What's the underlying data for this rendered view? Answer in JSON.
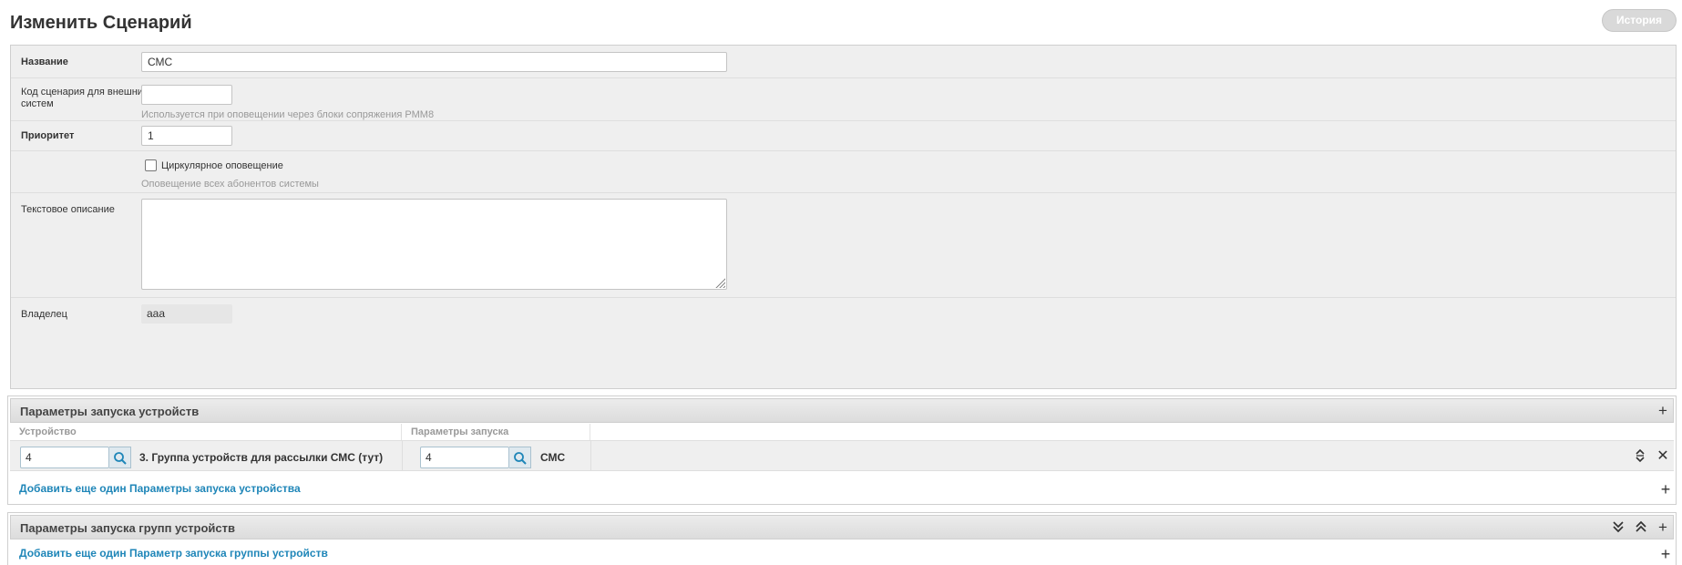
{
  "page": {
    "title": "Изменить Сценарий",
    "history_label": "История"
  },
  "form": {
    "name": {
      "label": "Название",
      "value": "СМС"
    },
    "external_code": {
      "label": "Код сценария для внешних систем",
      "value": "",
      "help": "Используется при оповещении через блоки сопряжения РММ8"
    },
    "priority": {
      "label": "Приоритет",
      "value": "1"
    },
    "circular": {
      "label": "Циркулярное оповещение",
      "checked": false,
      "help": "Оповещение всех абонентов системы"
    },
    "description": {
      "label": "Текстовое описание",
      "value": ""
    },
    "owner": {
      "label": "Владелец",
      "value": "aaa"
    }
  },
  "device_params": {
    "title": "Параметры запуска устройств",
    "columns": [
      "Устройство",
      "Параметры запуска"
    ],
    "rows": [
      {
        "device_id": "4",
        "device_name": "3. Группа устройств для рассылки СМС (тут)",
        "param_id": "4",
        "param_name": "СМС"
      }
    ],
    "add_label": "Добавить еще один Параметры запуска устройства"
  },
  "group_params": {
    "title": "Параметры запуска групп устройств",
    "add_label": "Добавить еще один Параметр запуска группы устройств"
  },
  "icons": {
    "plus": "plus-icon",
    "close": "close-icon",
    "sort": "sort-icon",
    "expand": "expand-all-icon",
    "collapse": "collapse-all-icon",
    "search": "search-icon"
  }
}
